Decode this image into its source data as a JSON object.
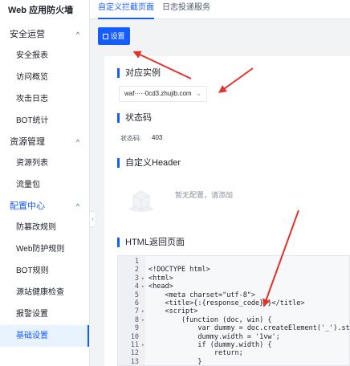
{
  "sidebar": {
    "brand": "Web 应用防火墙",
    "groups": [
      {
        "label": "安全运营",
        "items": [
          "安全报表",
          "访问概览",
          "攻击日志",
          "BOT统计"
        ]
      },
      {
        "label": "资源管理",
        "items": [
          "资源列表",
          "流量包"
        ]
      },
      {
        "label": "配置中心",
        "items": [
          "防篡改规则",
          "Web防护规则",
          "BOT规则",
          "源站健康检查",
          "报警设置",
          "基础设置"
        ]
      }
    ],
    "selected": "基础设置",
    "collapse_glyph": "‹",
    "chevron_glyph": "^"
  },
  "tabs": [
    "自定义拦截页面",
    "日志投递服务"
  ],
  "active_tab": "自定义拦截页面",
  "toolbar": {
    "settings_label": "设置"
  },
  "sections": {
    "instance": {
      "title": "对应实例",
      "select_value": "waf·····0cd3.zhujib.com",
      "select_arrow": "⌄"
    },
    "status": {
      "title": "状态码",
      "label": "状态码:",
      "value": "403"
    },
    "header": {
      "title": "自定义Header",
      "empty_text": "暂无配置，请添加"
    },
    "html": {
      "title": "HTML返回页面"
    }
  },
  "code": {
    "lines": [
      {
        "n": "1",
        "fold": "",
        "text": ""
      },
      {
        "n": "2",
        "fold": "",
        "text": "<!DOCTYPE html>"
      },
      {
        "n": "3",
        "fold": "▾",
        "text": "<html>"
      },
      {
        "n": "4",
        "fold": "▾",
        "text": "<head>"
      },
      {
        "n": "5",
        "fold": "",
        "text": "    <meta charset=\"utf-8\">"
      },
      {
        "n": "6",
        "fold": "",
        "text": "    <title>{:{response_code}:}</title>"
      },
      {
        "n": "7",
        "fold": "▾",
        "text": "    <script>"
      },
      {
        "n": "8",
        "fold": "▾",
        "text": "        (function (doc, win) {"
      },
      {
        "n": "9",
        "fold": "",
        "text": "            var dummy = doc.createElement('_').style;"
      },
      {
        "n": "10",
        "fold": "",
        "text": "            dummy.width = '1vw';"
      },
      {
        "n": "11",
        "fold": "▾",
        "text": "            if (dummy.width) {"
      },
      {
        "n": "12",
        "fold": "",
        "text": "                return;"
      },
      {
        "n": "13",
        "fold": "",
        "text": "            }"
      }
    ]
  },
  "colors": {
    "accent": "#165dff",
    "annotation": "#e5312b"
  }
}
